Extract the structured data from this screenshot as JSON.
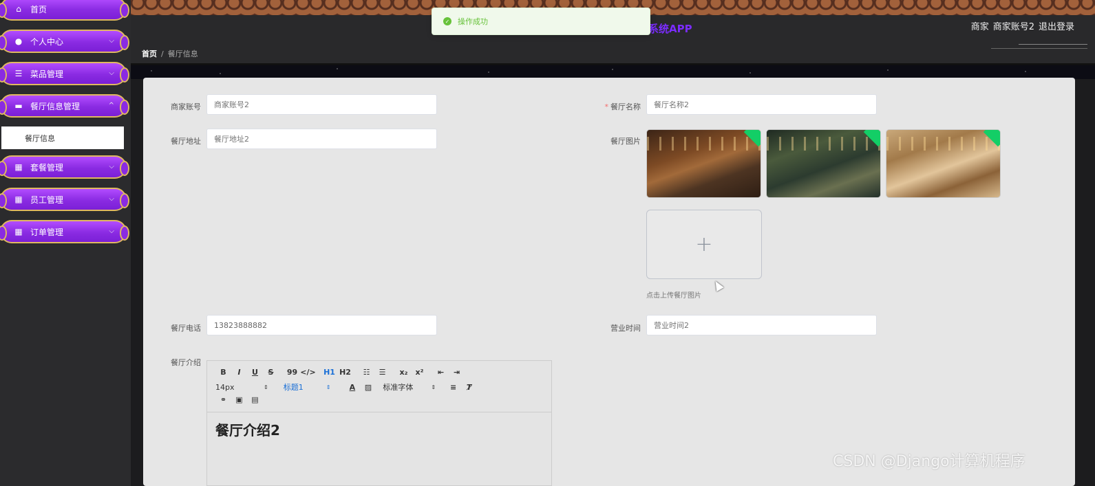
{
  "app": {
    "title_fragment": "系统APP"
  },
  "header": {
    "role": "商家",
    "username": "商家账号2",
    "logout": "退出登录"
  },
  "breadcrumb": {
    "home": "首页",
    "separator": "/",
    "current": "餐厅信息"
  },
  "sidebar": {
    "items": [
      {
        "label": "首页",
        "icon": "home-icon"
      },
      {
        "label": "个人中心",
        "icon": "user-icon"
      },
      {
        "label": "菜品管理",
        "icon": "list-icon"
      },
      {
        "label": "餐厅信息管理",
        "icon": "monitor-icon"
      },
      {
        "label": "套餐管理",
        "icon": "grid-icon"
      },
      {
        "label": "员工管理",
        "icon": "grid-icon"
      },
      {
        "label": "订单管理",
        "icon": "grid-icon"
      }
    ],
    "submenu": {
      "label": "餐厅信息"
    }
  },
  "form": {
    "merchant_account": {
      "label": "商家账号",
      "placeholder": "商家账号2"
    },
    "restaurant_name": {
      "label": "餐厅名称",
      "required": "*",
      "placeholder": "餐厅名称2"
    },
    "restaurant_address": {
      "label": "餐厅地址",
      "placeholder": "餐厅地址2"
    },
    "restaurant_images": {
      "label": "餐厅图片",
      "upload_hint": "点击上传餐厅图片",
      "upload_plus": "+"
    },
    "phone": {
      "label": "餐厅电话",
      "value": "13823888882"
    },
    "business_hours": {
      "label": "营业时间",
      "placeholder": "营业时间2"
    },
    "intro": {
      "label": "餐厅介绍",
      "content": "餐厅介绍2"
    }
  },
  "editor_toolbar": {
    "bold": "B",
    "italic": "I",
    "underline": "U",
    "strike": "S",
    "quote": "99",
    "code": "</>",
    "h1": "H1",
    "h2": "H2",
    "sub": "x₂",
    "sup": "x²",
    "font_size": "14px",
    "heading": "标题1",
    "font_family": "标准字体"
  },
  "toast": {
    "message": "操作成功"
  },
  "watermark": "CSDN @Django计算机程序"
}
